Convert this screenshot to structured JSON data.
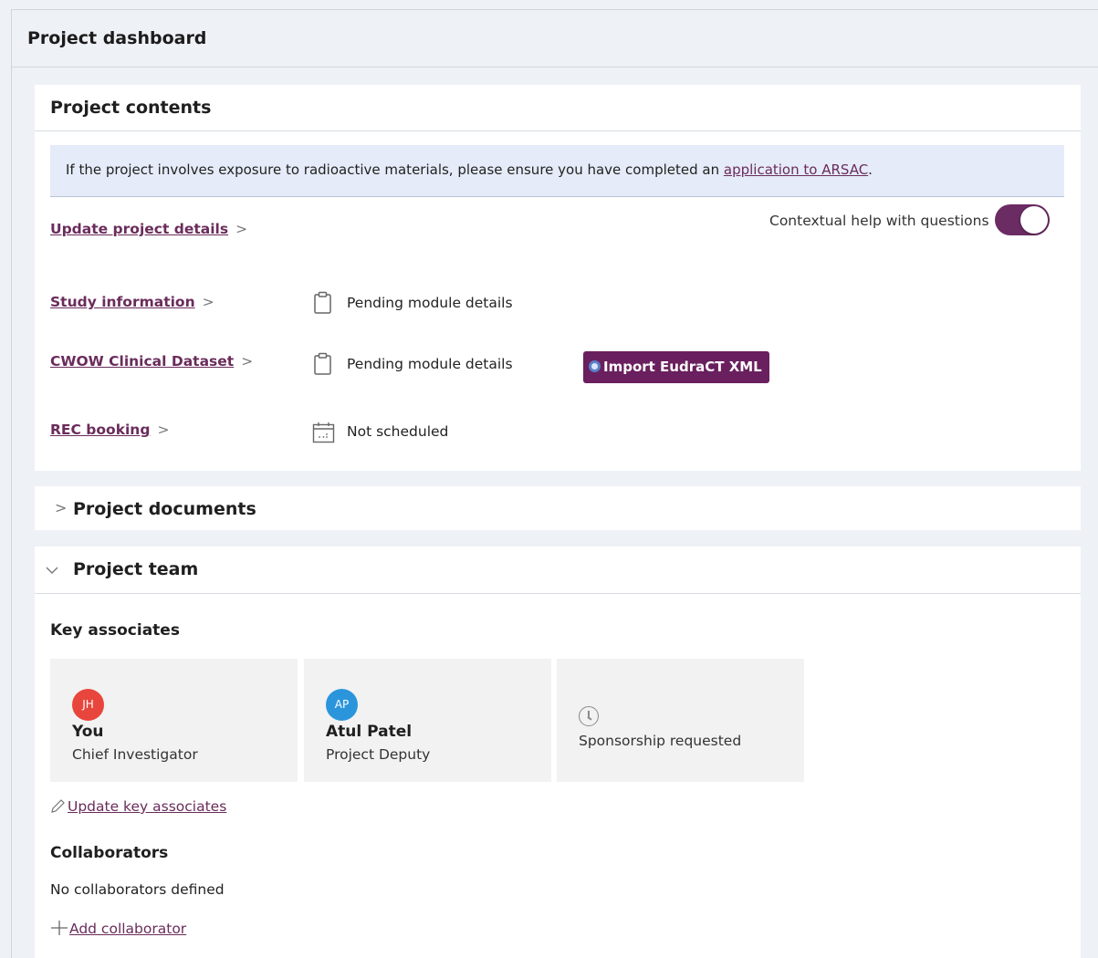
{
  "page": {
    "title": "Project dashboard"
  },
  "contents": {
    "title": "Project contents",
    "notice": {
      "text": "If the project involves exposure to radioactive materials, please ensure you have completed an ",
      "link": "application to ARSAC",
      "suffix": "."
    },
    "update_link": "Update project details",
    "help_label": "Contextual help with questions",
    "help_toggle_on": true,
    "rows": [
      {
        "label": "Study information",
        "status": "Pending module details",
        "icon": "clipboard-icon"
      },
      {
        "label": "CWOW Clinical Dataset",
        "status": "Pending module details",
        "icon": "clipboard-icon"
      },
      {
        "label": "REC booking",
        "status": "Not scheduled",
        "icon": "calendar-icon"
      }
    ],
    "import_button": "Import EudraCT XML"
  },
  "documents": {
    "title": "Project documents",
    "expanded": false
  },
  "team": {
    "title": "Project team",
    "expanded": true,
    "key_associates_heading": "Key associates",
    "associates": [
      {
        "initials": "JH",
        "name": "You",
        "role": "Chief Investigator",
        "color": "#e8463c"
      },
      {
        "initials": "AP",
        "name": "Atul Patel",
        "role": "Project Deputy",
        "color": "#2b95dc"
      }
    ],
    "sponsorship_status": "Sponsorship requested",
    "update_associates_link": "Update key associates",
    "collaborators_heading": "Collaborators",
    "collaborators_empty": "No collaborators defined",
    "add_collaborator_link": "Add collaborator"
  },
  "colors": {
    "brand": "#6a1f5e",
    "link": "#6a2c5b",
    "notice_bg": "#e5ebf8"
  }
}
